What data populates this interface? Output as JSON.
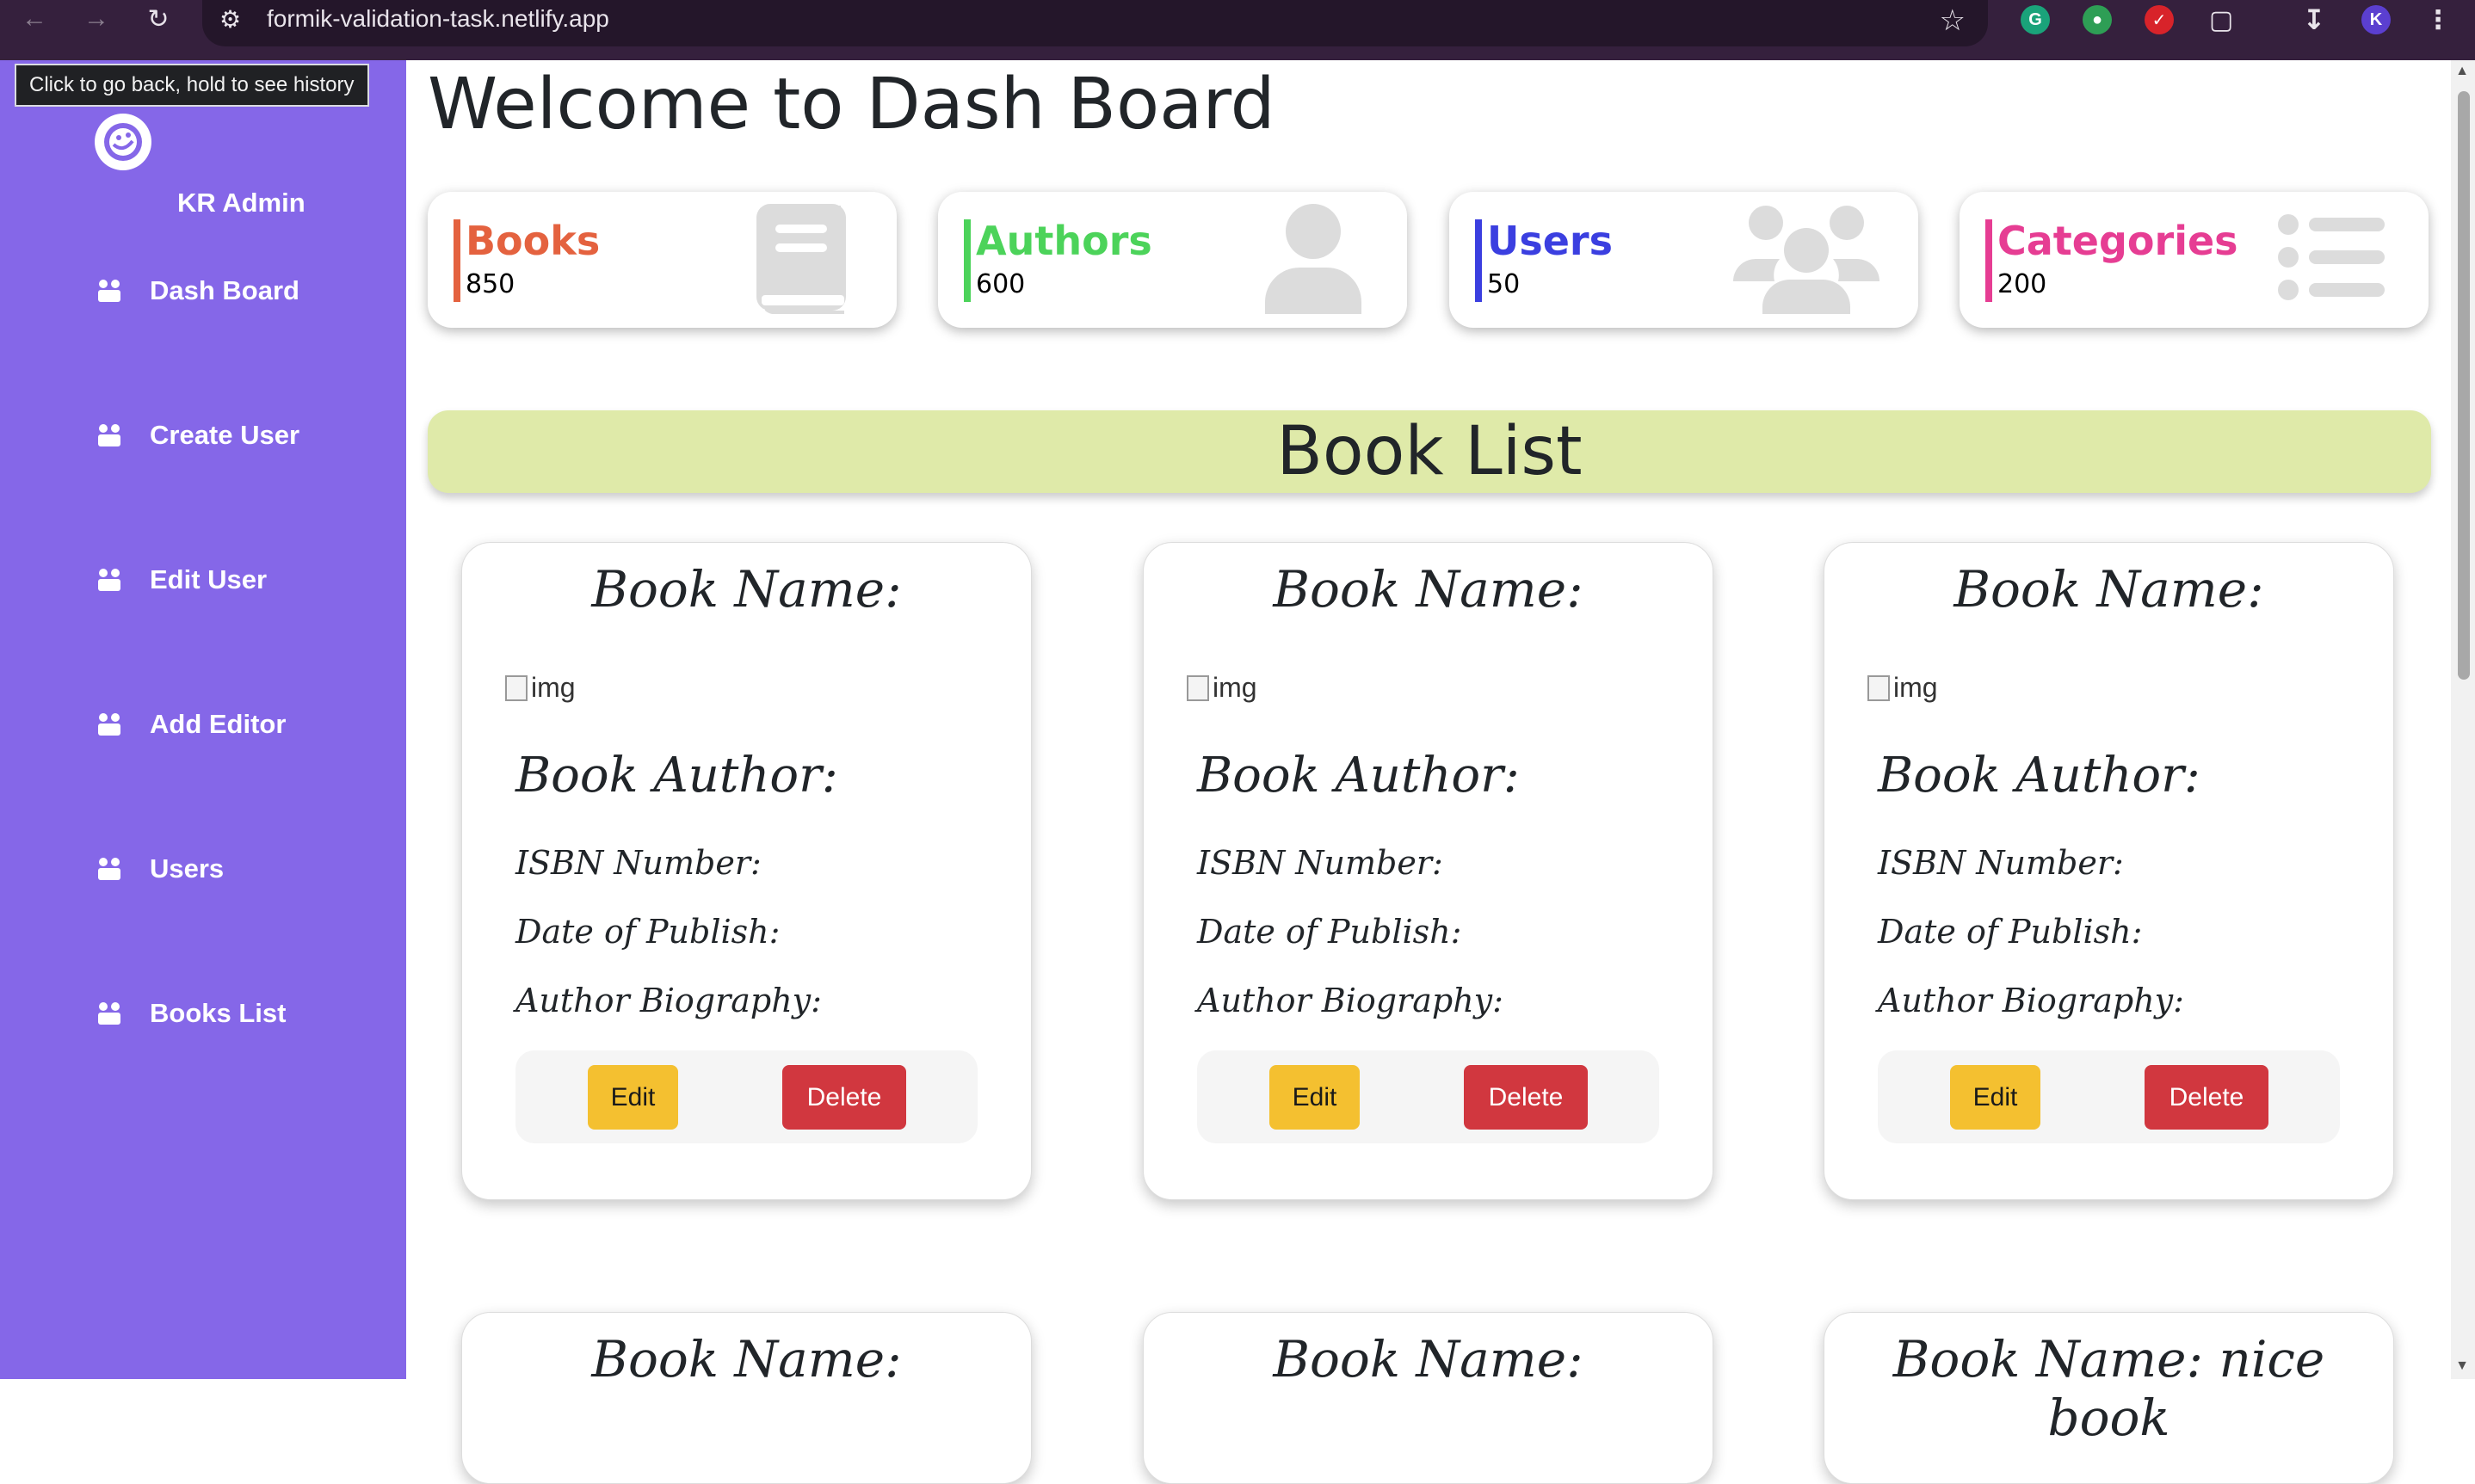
{
  "browser": {
    "url": "formik-validation-task.netlify.app",
    "tooltip": "Click to go back, hold to see history",
    "profile_initial": "K"
  },
  "sidebar": {
    "brand": "KR Admin",
    "items": [
      {
        "label": "Dash Board"
      },
      {
        "label": "Create User"
      },
      {
        "label": "Edit User"
      },
      {
        "label": "Add Editor"
      },
      {
        "label": "Users"
      },
      {
        "label": "Books List"
      }
    ]
  },
  "main": {
    "title": "Welcome to Dash Board",
    "stats": [
      {
        "label": "Books",
        "value": "850",
        "color": "#e4623f",
        "icon": "book-icon"
      },
      {
        "label": "Authors",
        "value": "600",
        "color": "#4cd35a",
        "icon": "user-icon"
      },
      {
        "label": "Users",
        "value": "50",
        "color": "#3b3fe0",
        "icon": "users-icon"
      },
      {
        "label": "Categories",
        "value": "200",
        "color": "#e63d93",
        "icon": "list-icon"
      }
    ],
    "section_title": "Book List",
    "book_cards": [
      {
        "name_label": "Book Name:",
        "img_alt": "img",
        "author_label": "Book Author:",
        "isbn_label": "ISBN Number:",
        "publish_label": "Date of Publish:",
        "bio_label": "Author Biography:",
        "edit": "Edit",
        "delete": "Delete"
      },
      {
        "name_label": "Book Name:",
        "img_alt": "img",
        "author_label": "Book Author:",
        "isbn_label": "ISBN Number:",
        "publish_label": "Date of Publish:",
        "bio_label": "Author Biography:",
        "edit": "Edit",
        "delete": "Delete"
      },
      {
        "name_label": "Book Name:",
        "img_alt": "img",
        "author_label": "Book Author:",
        "isbn_label": "ISBN Number:",
        "publish_label": "Date of Publish:",
        "bio_label": "Author Biography:",
        "edit": "Edit",
        "delete": "Delete"
      }
    ],
    "book_cards_row2": [
      {
        "name_label": "Book Name:"
      },
      {
        "name_label": "Book Name:"
      },
      {
        "name_label": "Book Name: nice book"
      }
    ]
  },
  "colors": {
    "sidebar_bg": "#8567e8",
    "banner_bg": "#dfeaa9",
    "edit_button": "#f4c030",
    "delete_button": "#d1373f"
  }
}
